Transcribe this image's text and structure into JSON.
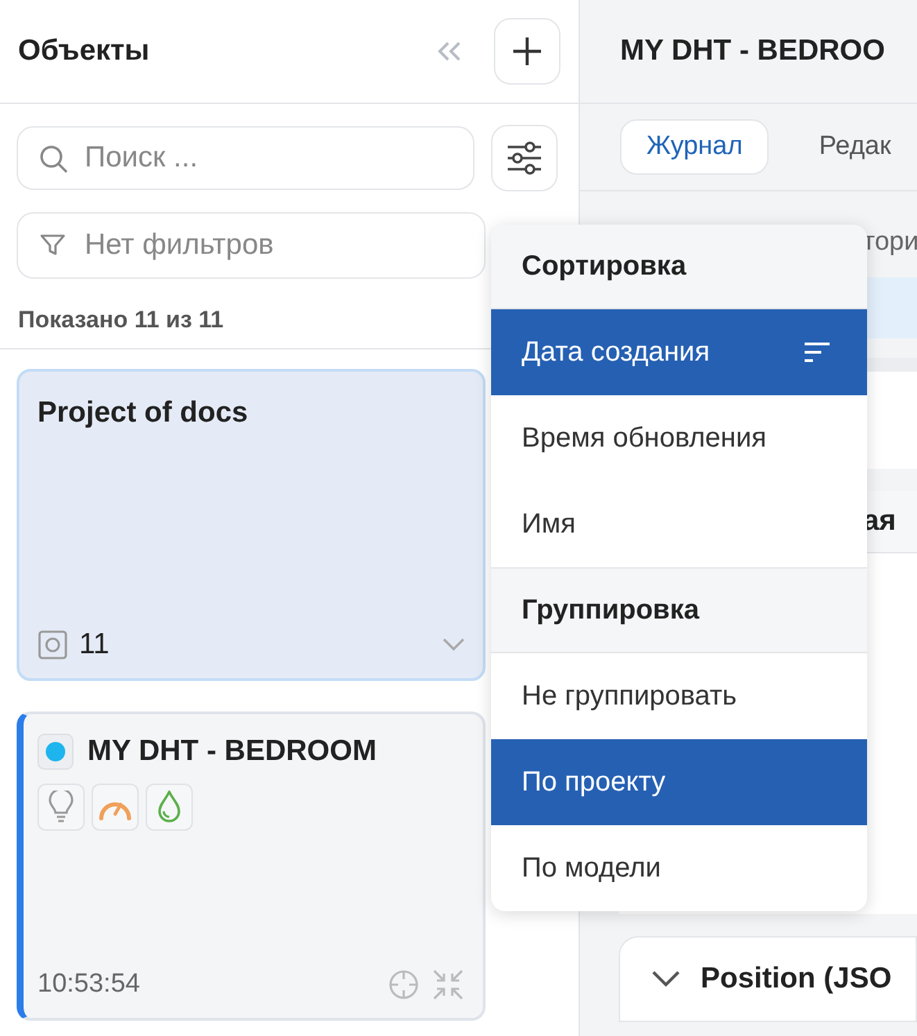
{
  "sidebar": {
    "title": "Объекты",
    "search": {
      "placeholder": "Поиск ..."
    },
    "filter": {
      "placeholder": "Нет фильтров"
    },
    "count": "Показано 11 из 11",
    "cards": [
      {
        "kind": "project",
        "title": "Project of docs",
        "count": "11",
        "selected": true,
        "opened": false
      },
      {
        "kind": "device",
        "title": "MY DHT - BEDROOM",
        "color": "#1eb4ee",
        "time": "10:53:54",
        "selected": false,
        "opened": true
      }
    ]
  },
  "detail": {
    "title": "MY DHT - BEDROO",
    "tabs": [
      {
        "label": "Журнал",
        "selected": true
      },
      {
        "label": "Редак",
        "selected": false
      }
    ],
    "fragment": "тори",
    "section_title": "ая",
    "position_title": "Position (JSO"
  },
  "menu": {
    "sections": [
      {
        "kind": "sort",
        "title": "Сортировка",
        "items": [
          {
            "label": "Дата создания",
            "selected": true
          },
          {
            "label": "Время обновления",
            "selected": false
          },
          {
            "label": "Имя",
            "selected": false
          }
        ]
      },
      {
        "kind": "group",
        "title": "Группировка",
        "items": [
          {
            "label": "Не группировать",
            "selected": false
          },
          {
            "label": "По проекту",
            "selected": true
          },
          {
            "label": "По модели",
            "selected": false
          }
        ]
      }
    ]
  }
}
